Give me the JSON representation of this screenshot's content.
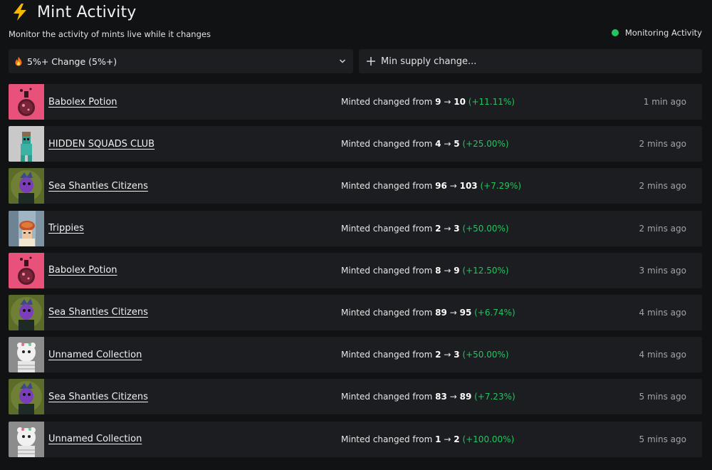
{
  "header": {
    "title": "Mint Activity",
    "subtitle": "Monitor the activity of mints live while it changes",
    "status": "Monitoring Activity"
  },
  "colors": {
    "accent_green": "#22c55e",
    "background": "#111214",
    "row_bg": "#1c1d20"
  },
  "filters": {
    "change_select": {
      "selected": "5%+ Change (5%+)",
      "icon": "flame-icon"
    },
    "min_supply": {
      "placeholder": "Min supply change..."
    }
  },
  "rows": [
    {
      "name": "Babolex Potion",
      "thumb": "potion",
      "prefix": "Minted changed from",
      "from": "9",
      "arrow": "→",
      "to": "10",
      "pct": "(+11.11%)",
      "time": "1 min ago"
    },
    {
      "name": "HIDDEN SQUADS CLUB",
      "thumb": "squad",
      "prefix": "Minted changed from",
      "from": "4",
      "arrow": "→",
      "to": "5",
      "pct": "(+25.00%)",
      "time": "2 mins ago"
    },
    {
      "name": "Sea Shanties Citizens",
      "thumb": "sea",
      "prefix": "Minted changed from",
      "from": "96",
      "arrow": "→",
      "to": "103",
      "pct": "(+7.29%)",
      "time": "2 mins ago"
    },
    {
      "name": "Trippies",
      "thumb": "trippies",
      "prefix": "Minted changed from",
      "from": "2",
      "arrow": "→",
      "to": "3",
      "pct": "(+50.00%)",
      "time": "2 mins ago"
    },
    {
      "name": "Babolex Potion",
      "thumb": "potion",
      "prefix": "Minted changed from",
      "from": "8",
      "arrow": "→",
      "to": "9",
      "pct": "(+12.50%)",
      "time": "3 mins ago"
    },
    {
      "name": "Sea Shanties Citizens",
      "thumb": "sea",
      "prefix": "Minted changed from",
      "from": "89",
      "arrow": "→",
      "to": "95",
      "pct": "(+6.74%)",
      "time": "4 mins ago"
    },
    {
      "name": "Unnamed Collection",
      "thumb": "unnamed",
      "prefix": "Minted changed from",
      "from": "2",
      "arrow": "→",
      "to": "3",
      "pct": "(+50.00%)",
      "time": "4 mins ago"
    },
    {
      "name": "Sea Shanties Citizens",
      "thumb": "sea",
      "prefix": "Minted changed from",
      "from": "83",
      "arrow": "→",
      "to": "89",
      "pct": "(+7.23%)",
      "time": "5 mins ago"
    },
    {
      "name": "Unnamed Collection",
      "thumb": "unnamed",
      "prefix": "Minted changed from",
      "from": "1",
      "arrow": "→",
      "to": "2",
      "pct": "(+100.00%)",
      "time": "5 mins ago"
    }
  ]
}
